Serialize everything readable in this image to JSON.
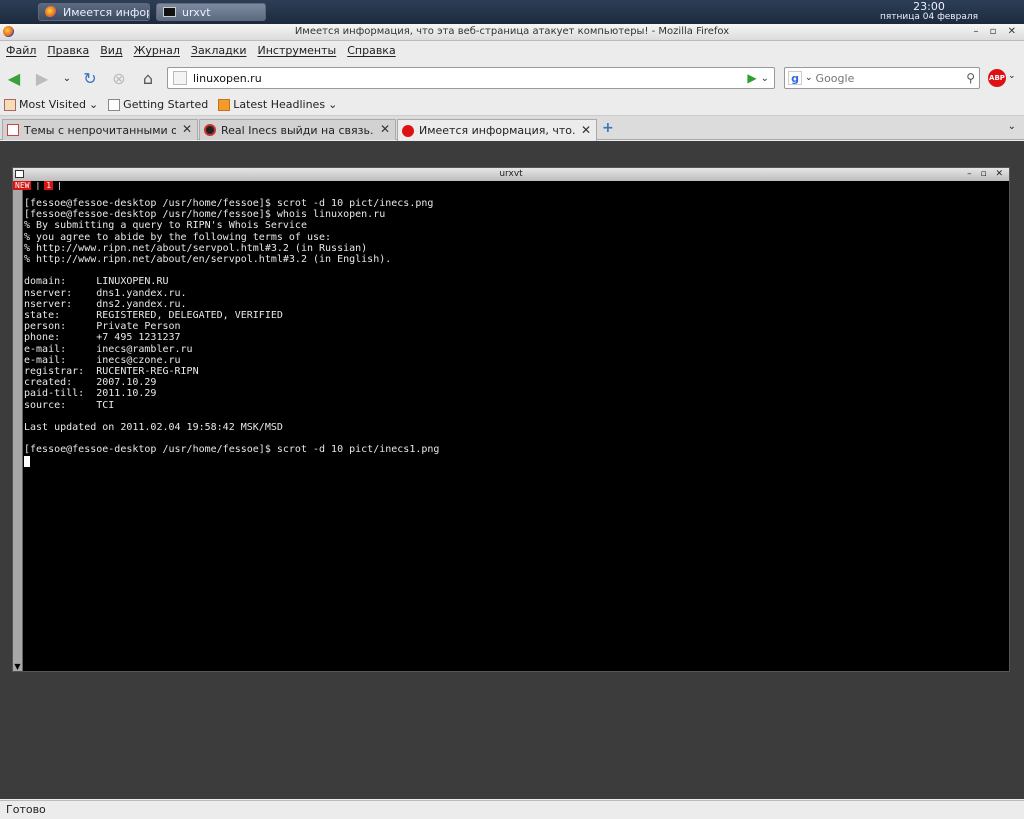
{
  "panel": {
    "tasks": [
      "Имеется инфор...",
      "urxvt"
    ],
    "clock_time": "23:00",
    "clock_date": "пятница 04 февраля"
  },
  "firefox": {
    "title": "Имеется информация, что эта веб-страница атакует компьютеры! - Mozilla Firefox",
    "menu": [
      "Файл",
      "Правка",
      "Вид",
      "Журнал",
      "Закладки",
      "Инструменты",
      "Справка"
    ],
    "url": "linuxopen.ru",
    "search_placeholder": "Google",
    "abp_label": "ABP",
    "bookmarks": [
      "Most Visited",
      "Getting Started",
      "Latest Headlines"
    ],
    "tabs": [
      "Темы с непрочитанными о...",
      "Real Inecs выйди на связь...",
      "Имеется информация, что..."
    ],
    "status": "Готово"
  },
  "urxvt": {
    "title": "urxvt",
    "tabs": [
      "NEW",
      "1"
    ],
    "lines": [
      "[fessoe@fessoe-desktop /usr/home/fessoe]$ scrot -d 10 pict/inecs.png",
      "[fessoe@fessoe-desktop /usr/home/fessoe]$ whois linuxopen.ru",
      "% By submitting a query to RIPN's Whois Service",
      "% you agree to abide by the following terms of use:",
      "% http://www.ripn.net/about/servpol.html#3.2 (in Russian)",
      "% http://www.ripn.net/about/en/servpol.html#3.2 (in English).",
      "",
      "domain:     LINUXOPEN.RU",
      "nserver:    dns1.yandex.ru.",
      "nserver:    dns2.yandex.ru.",
      "state:      REGISTERED, DELEGATED, VERIFIED",
      "person:     Private Person",
      "phone:      +7 495 1231237",
      "e-mail:     inecs@rambler.ru",
      "e-mail:     inecs@czone.ru",
      "registrar:  RUCENTER-REG-RIPN",
      "created:    2007.10.29",
      "paid-till:  2011.10.29",
      "source:     TCI",
      "",
      "Last updated on 2011.02.04 19:58:42 MSK/MSD",
      "",
      "[fessoe@fessoe-desktop /usr/home/fessoe]$ scrot -d 10 pict/inecs1.png"
    ]
  }
}
